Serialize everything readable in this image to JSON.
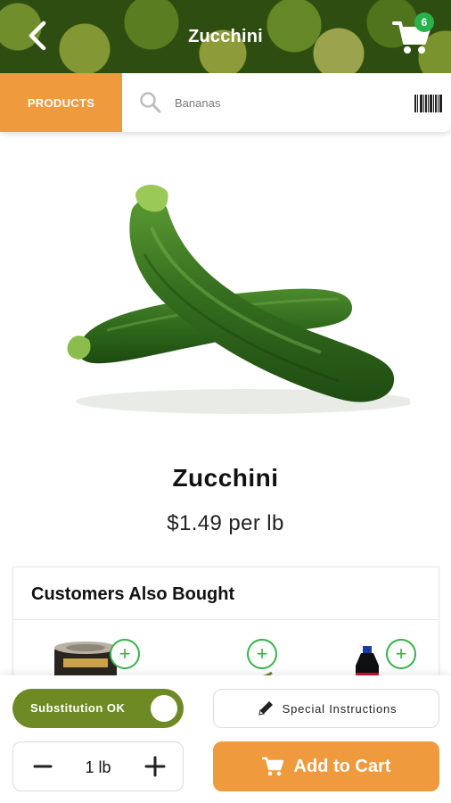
{
  "header": {
    "title": "Zucchini",
    "back_icon": "chevron-left-icon",
    "cart_icon": "cart-icon",
    "cart_count": "6"
  },
  "search": {
    "category_label": "PRODUCTS",
    "placeholder": "Bananas",
    "search_icon": "search-icon",
    "barcode_icon": "barcode-icon"
  },
  "product": {
    "name": "Zucchini",
    "price": "$1.49 per lb"
  },
  "also_bought": {
    "title": "Customers Also Bought",
    "add_symbol": "+"
  },
  "actions": {
    "substitution_label": "Substitution OK",
    "special_label": "Special Instructions",
    "quantity": "1 lb",
    "add_to_cart_label": "Add to Cart"
  },
  "colors": {
    "accent_orange": "#ef9a3c",
    "toggle_green": "#6e8a24",
    "badge_green": "#2ab24a"
  }
}
